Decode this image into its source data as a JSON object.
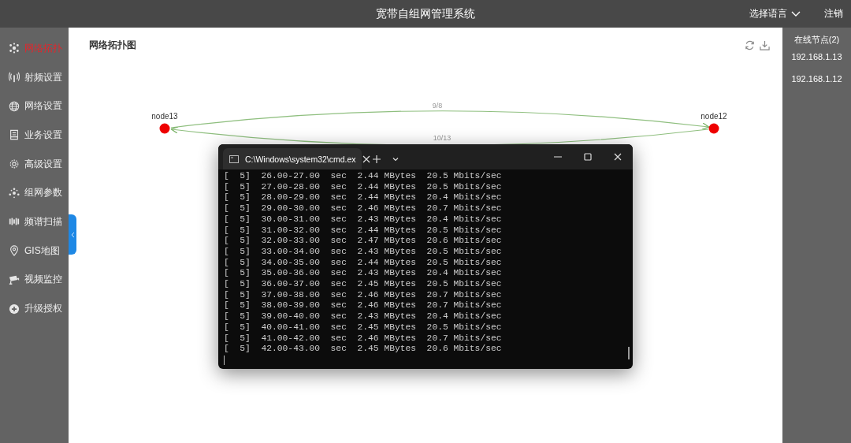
{
  "header": {
    "title": "宽带自组网管理系统",
    "language_menu": "选择语言",
    "logout": "注销"
  },
  "sidebar": {
    "items": [
      {
        "label": "网络拓扑",
        "kind": "nodes",
        "selected": true
      },
      {
        "label": "射频设置",
        "kind": "antenna",
        "selected": false
      },
      {
        "label": "网络设置",
        "kind": "globe",
        "selected": false
      },
      {
        "label": "业务设置",
        "kind": "doc",
        "selected": false
      },
      {
        "label": "高级设置",
        "kind": "gear",
        "selected": false
      },
      {
        "label": "组网参数",
        "kind": "dots",
        "selected": false
      },
      {
        "label": "频谱扫描",
        "kind": "spectrum",
        "selected": false
      },
      {
        "label": "GIS地图",
        "kind": "pin",
        "selected": false
      },
      {
        "label": "视频监控",
        "kind": "camera",
        "selected": false
      },
      {
        "label": "升级授权",
        "kind": "plus",
        "selected": false
      }
    ]
  },
  "topology": {
    "title": "网络拓扑图",
    "nodes": [
      {
        "label": "node13"
      },
      {
        "label": "node12"
      }
    ],
    "links": [
      {
        "label": "9/8"
      },
      {
        "label": "10/13"
      }
    ]
  },
  "terminal": {
    "tab_title": "C:\\Windows\\system32\\cmd.ex",
    "lines": [
      "[  5]  26.00-27.00  sec  2.44 MBytes  20.5 Mbits/sec",
      "[  5]  27.00-28.00  sec  2.44 MBytes  20.5 Mbits/sec",
      "[  5]  28.00-29.00  sec  2.44 MBytes  20.4 Mbits/sec",
      "[  5]  29.00-30.00  sec  2.46 MBytes  20.7 Mbits/sec",
      "[  5]  30.00-31.00  sec  2.43 MBytes  20.4 Mbits/sec",
      "[  5]  31.00-32.00  sec  2.44 MBytes  20.5 Mbits/sec",
      "[  5]  32.00-33.00  sec  2.47 MBytes  20.6 Mbits/sec",
      "[  5]  33.00-34.00  sec  2.43 MBytes  20.5 Mbits/sec",
      "[  5]  34.00-35.00  sec  2.44 MBytes  20.5 Mbits/sec",
      "[  5]  35.00-36.00  sec  2.43 MBytes  20.4 Mbits/sec",
      "[  5]  36.00-37.00  sec  2.45 MBytes  20.5 Mbits/sec",
      "[  5]  37.00-38.00  sec  2.46 MBytes  20.7 Mbits/sec",
      "[  5]  38.00-39.00  sec  2.46 MBytes  20.7 Mbits/sec",
      "[  5]  39.00-40.00  sec  2.43 MBytes  20.4 Mbits/sec",
      "[  5]  40.00-41.00  sec  2.45 MBytes  20.5 Mbits/sec",
      "[  5]  41.00-42.00  sec  2.46 MBytes  20.7 Mbits/sec",
      "[  5]  42.00-43.00  sec  2.45 MBytes  20.6 Mbits/sec"
    ]
  },
  "online_nodes": {
    "title": "在线节点(2)",
    "items": [
      "192.168.1.13",
      "192.168.1.12"
    ]
  }
}
